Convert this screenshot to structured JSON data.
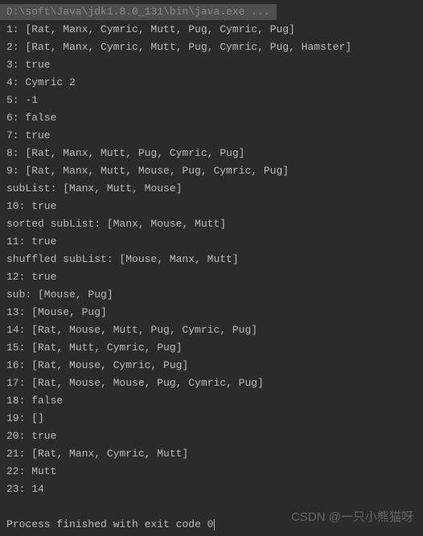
{
  "command": "D:\\soft\\Java\\jdk1.8.0_131\\bin\\java.exe ...",
  "lines": [
    "1: [Rat, Manx, Cymric, Mutt, Pug, Cymric, Pug]",
    "2: [Rat, Manx, Cymric, Mutt, Pug, Cymric, Pug, Hamster]",
    "3: true",
    "4: Cymric 2",
    "5: -1",
    "6: false",
    "7: true",
    "8: [Rat, Manx, Mutt, Pug, Cymric, Pug]",
    "9: [Rat, Manx, Mutt, Mouse, Pug, Cymric, Pug]",
    "subList: [Manx, Mutt, Mouse]",
    "10: true",
    "sorted subList: [Manx, Mouse, Mutt]",
    "11: true",
    "shuffled subList: [Mouse, Manx, Mutt]",
    "12: true",
    "sub: [Mouse, Pug]",
    "13: [Mouse, Pug]",
    "14: [Rat, Mouse, Mutt, Pug, Cymric, Pug]",
    "15: [Rat, Mutt, Cymric, Pug]",
    "16: [Rat, Mouse, Cymric, Pug]",
    "17: [Rat, Mouse, Mouse, Pug, Cymric, Pug]",
    "18: false",
    "19: []",
    "20: true",
    "21: [Rat, Manx, Cymric, Mutt]",
    "22: Mutt",
    "23: 14"
  ],
  "exit_message": "Process finished with exit code 0",
  "watermark": "CSDN @一只小熊猫呀"
}
